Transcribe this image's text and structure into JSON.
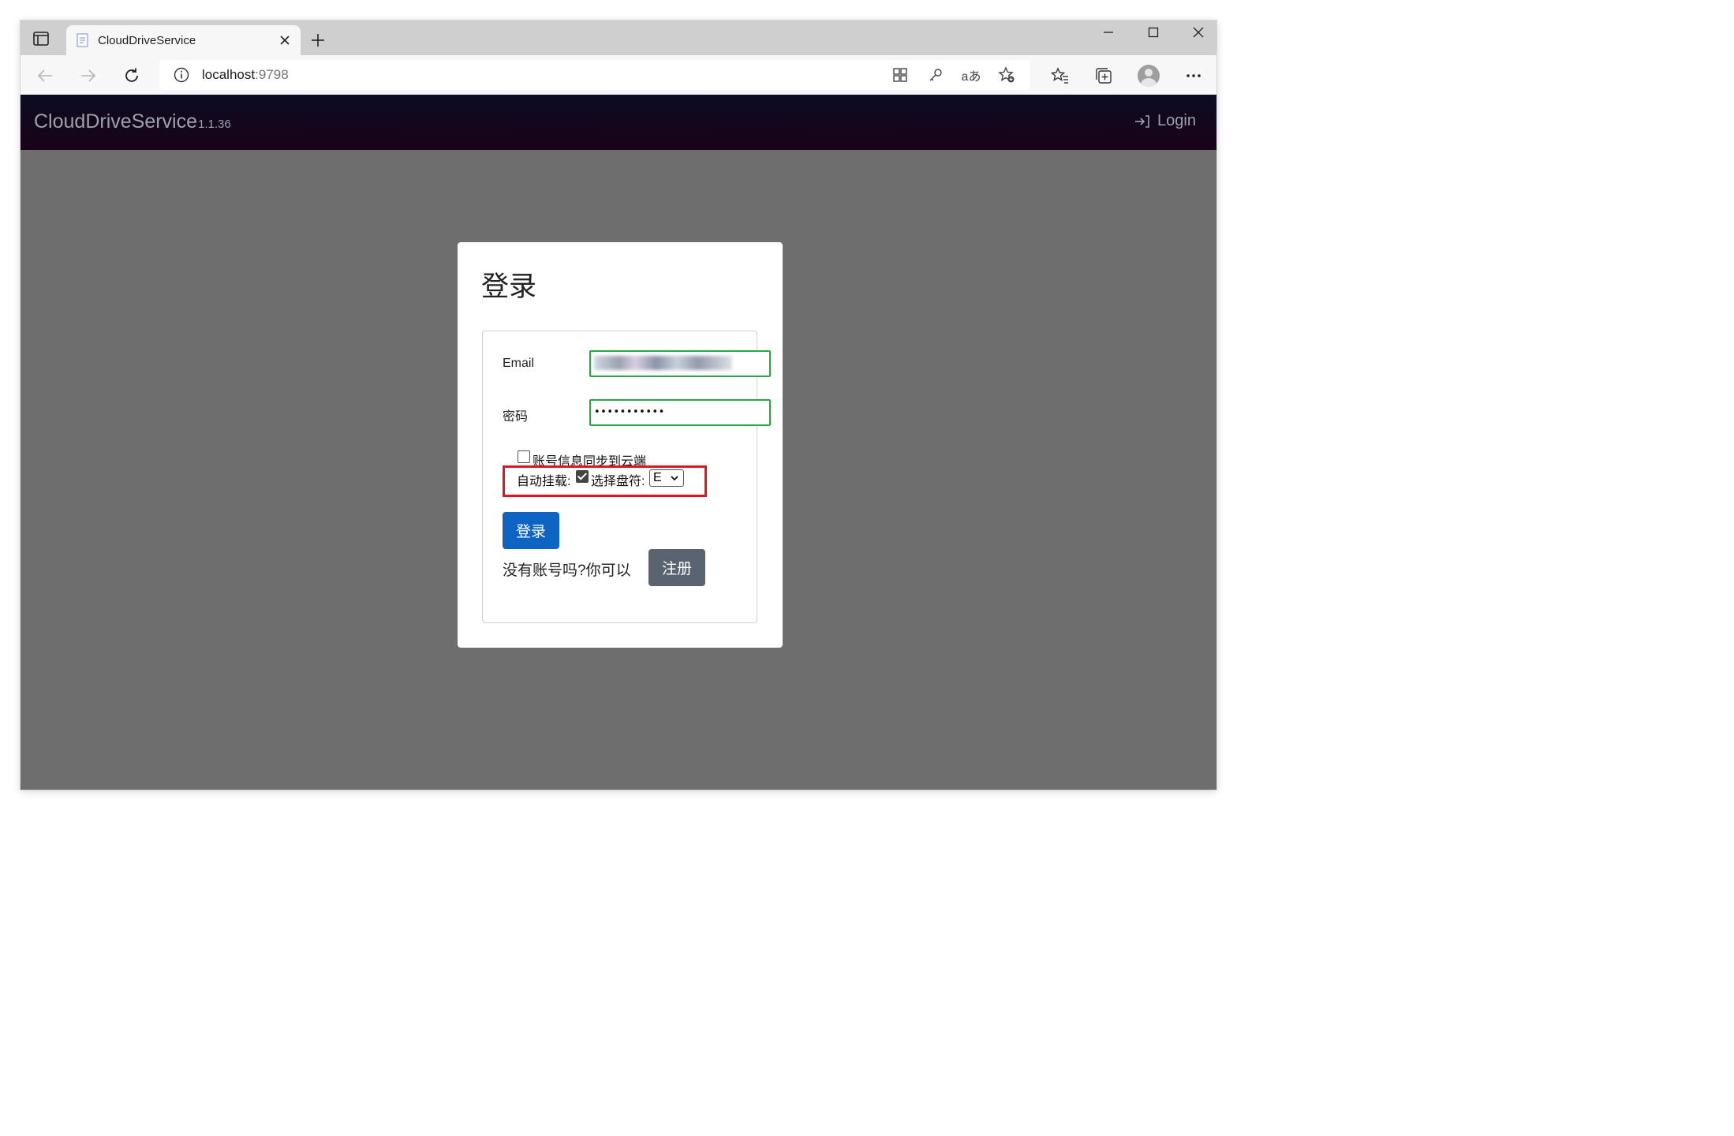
{
  "browser": {
    "tab": {
      "title": "CloudDriveService"
    },
    "address": {
      "url_host": "localhost",
      "url_port": ":9798"
    },
    "toolbar_icons": [
      "app-available-icon",
      "password-key-icon",
      "read-aloud-icon",
      "add-favorite-icon",
      "favorites-icon",
      "collections-icon",
      "profile-avatar",
      "more-menu-icon"
    ],
    "read_aloud_label": "aあ"
  },
  "app": {
    "brand": "CloudDriveService",
    "version": "1.1.36",
    "login_link": "Login"
  },
  "login": {
    "heading": "登录",
    "email_label": "Email",
    "password_label": "密码",
    "password_value": "•••••••••••",
    "sync_label": "账号信息同步到云端",
    "sync_checked": false,
    "automount_label": "自动挂载:",
    "automount_checked": true,
    "drive_label": "选择盘符:",
    "drive_value": "E",
    "submit_label": "登录",
    "no_account_text": "没有账号吗?你可以",
    "register_label": "注册"
  },
  "colors": {
    "page_bg": "#6e6e6e",
    "appbar_top": "#0b0c22",
    "appbar_bottom": "#1a0219",
    "primary": "#0d64c2",
    "secondary": "#5a6470",
    "valid_border": "#28a745",
    "highlight": "#e3141b"
  }
}
